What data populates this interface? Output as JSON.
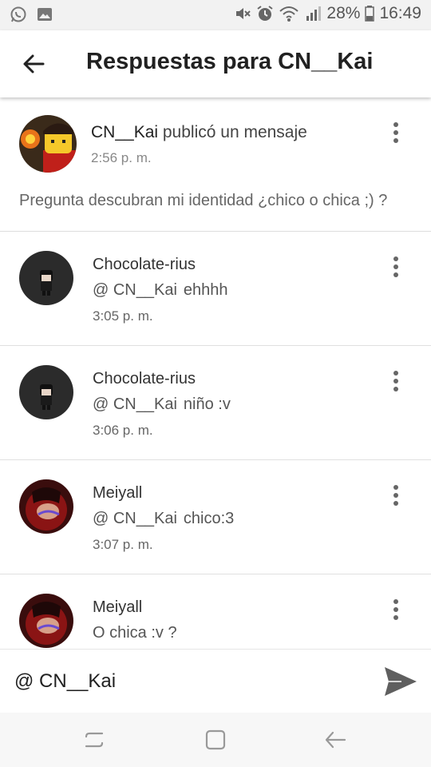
{
  "status_bar": {
    "battery": "28%",
    "time": "16:49",
    "left_icons": [
      "whatsapp-icon",
      "gallery-icon"
    ],
    "right_icons": [
      "mute-icon",
      "alarm-icon",
      "wifi-icon",
      "signal-icon",
      "battery-icon"
    ]
  },
  "app_bar": {
    "title": "Respuestas para CN__Kai"
  },
  "post": {
    "author": "CN__Kai",
    "action": " publicó un mensaje",
    "time": "2:56 p. m.",
    "body": "Pregunta descubran mi identidad ¿chico o chica ;) ?"
  },
  "replies": [
    {
      "user": "Chocolate-rius",
      "mention": "@ CN__Kai",
      "text": "ehhhh",
      "time": "3:05 p. m."
    },
    {
      "user": "Chocolate-rius",
      "mention": "@ CN__Kai",
      "text": "niño :v",
      "time": "3:06 p. m."
    },
    {
      "user": "Meiyall",
      "mention": "@ CN__Kai",
      "text": "chico:3",
      "time": "3:07 p. m."
    },
    {
      "user": "Meiyall",
      "mention": "",
      "text": "O chica :v ?",
      "time": ""
    }
  ],
  "composer": {
    "value": "@ CN__Kai"
  },
  "colors": {
    "status_bar_bg": "#f2f2f2",
    "app_bar_bg": "#ffffff",
    "text_primary": "#212121",
    "text_secondary": "#666666",
    "send_icon": "#5f5f5f"
  }
}
